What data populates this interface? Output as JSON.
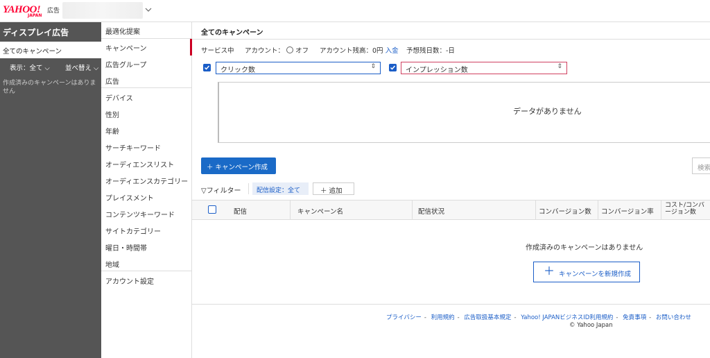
{
  "header": {
    "logo_text": "YAHOO!",
    "logo_sub": "JAPAN",
    "logo_ad": "広告"
  },
  "sidebar": {
    "title": "ディスプレイ広告",
    "all_campaigns": "全てのキャンペーン",
    "display_opt": "表示：全て",
    "sort_opt": "並べ替え",
    "empty_text": "作成済みのキャンペーンはありません"
  },
  "nav": {
    "items": [
      {
        "label": "最適化提案"
      },
      {
        "label": "キャンペーン"
      },
      {
        "label": "広告グループ"
      },
      {
        "label": "広告"
      },
      {
        "label": "デバイス"
      },
      {
        "label": "性別"
      },
      {
        "label": "年齢"
      },
      {
        "label": "サーチキーワード"
      },
      {
        "label": "オーディエンスリスト"
      },
      {
        "label": "オーディエンスカテゴリー"
      },
      {
        "label": "プレイスメント"
      },
      {
        "label": "コンテンツキーワード"
      },
      {
        "label": "サイトカテゴリー"
      },
      {
        "label": "曜日・時間帯"
      },
      {
        "label": "地域"
      },
      {
        "label": "アカウント設定"
      }
    ]
  },
  "main": {
    "title": "全てのキャンペーン",
    "service_status": "サービス中",
    "account_label": "アカウント：",
    "account_state": "オフ",
    "balance_label": "アカウント残高：0円",
    "deposit_link": "入金",
    "remaining_days": "予想残日数：-日",
    "metric1": "クリック数",
    "metric2": "インプレッション数",
    "no_data": "データがありません",
    "create_button": "＋ キャンペーン作成",
    "search_button": "検索",
    "filter_label": "フィルター",
    "filter_tag": "配信設定：全て",
    "add_button": "＋ 追加",
    "columns": [
      "配信",
      "キャンペーン名",
      "配信状況",
      "コンバージョン数",
      "コンバージョン率",
      "コスト/コンバージョン数"
    ],
    "empty_message": "作成済みのキャンペーンはありません",
    "new_campaign_button": "キャンペーンを新規作成"
  },
  "footer": {
    "links": [
      "プライバシー",
      "利用規約",
      "広告取扱基本規定",
      "Yahoo! JAPANビジネスID利用規約",
      "免責事項",
      "お問い合わせ"
    ],
    "copyright": "© Yahoo Japan"
  },
  "colors": {
    "brand_red": "#ff0033",
    "accent_blue": "#1a6ac7",
    "active_nav": "#cc0022",
    "sidebar_bg": "#555555"
  }
}
